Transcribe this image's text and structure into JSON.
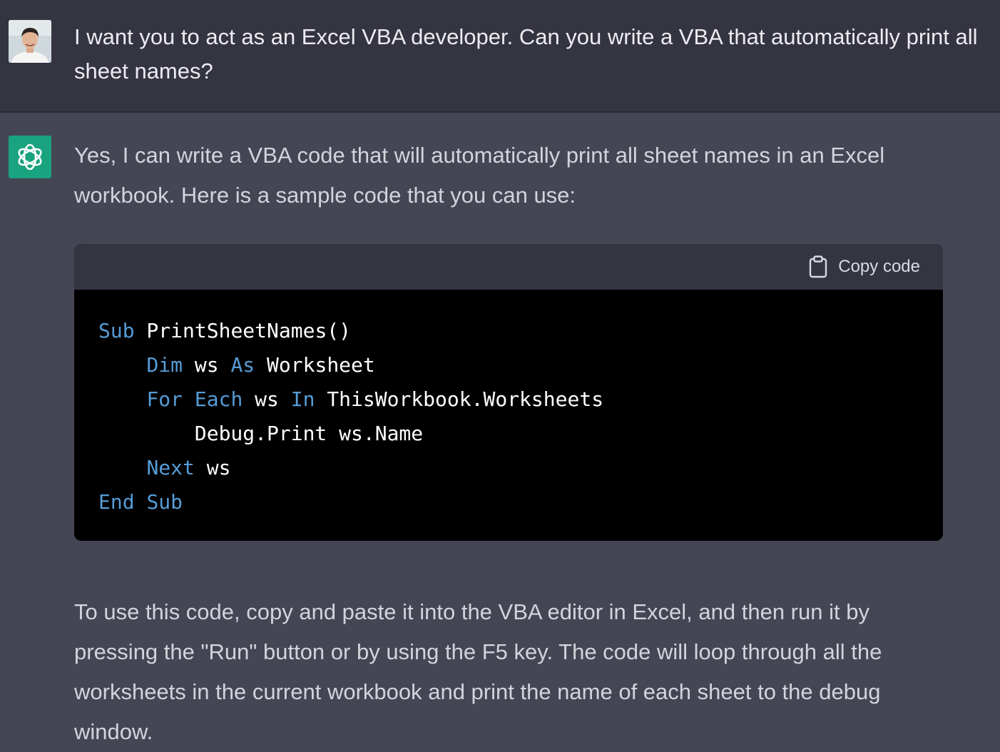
{
  "user_message": {
    "text": "I want you to act as an Excel VBA developer. Can you write a VBA that automatically print all sheet names?"
  },
  "assistant_message": {
    "intro": "Yes, I can write a VBA code that will automatically print all sheet names in an Excel workbook. Here is a sample code that you can use:",
    "code_block": {
      "copy_label": "Copy code",
      "copy_icon": "clipboard-icon",
      "lines": [
        {
          "indent": "",
          "tokens": [
            {
              "t": "Sub",
              "kw": true
            },
            {
              "t": " PrintSheetNames()",
              "kw": false
            }
          ]
        },
        {
          "indent": "    ",
          "tokens": [
            {
              "t": "Dim",
              "kw": true
            },
            {
              "t": " ws ",
              "kw": false
            },
            {
              "t": "As",
              "kw": true
            },
            {
              "t": " Worksheet",
              "kw": false
            }
          ]
        },
        {
          "indent": "    ",
          "tokens": [
            {
              "t": "For",
              "kw": true
            },
            {
              "t": " ",
              "kw": false
            },
            {
              "t": "Each",
              "kw": true
            },
            {
              "t": " ws ",
              "kw": false
            },
            {
              "t": "In",
              "kw": true
            },
            {
              "t": " ThisWorkbook.Worksheets",
              "kw": false
            }
          ]
        },
        {
          "indent": "        ",
          "tokens": [
            {
              "t": "Debug.Print ws.Name",
              "kw": false
            }
          ]
        },
        {
          "indent": "    ",
          "tokens": [
            {
              "t": "Next",
              "kw": true
            },
            {
              "t": " ws",
              "kw": false
            }
          ]
        },
        {
          "indent": "",
          "tokens": [
            {
              "t": "End",
              "kw": true
            },
            {
              "t": " ",
              "kw": false
            },
            {
              "t": "Sub",
              "kw": true
            }
          ]
        }
      ]
    },
    "outro": "To use this code, copy and paste it into the VBA editor in Excel, and then run it by pressing the \"Run\" button or by using the F5 key. The code will loop through all the worksheets in the current workbook and print the name of each sheet to the debug window."
  },
  "colors": {
    "user_bg": "#343541",
    "assistant_bg": "#444654",
    "bot_avatar": "#19a37f",
    "keyword": "#569cd6"
  }
}
